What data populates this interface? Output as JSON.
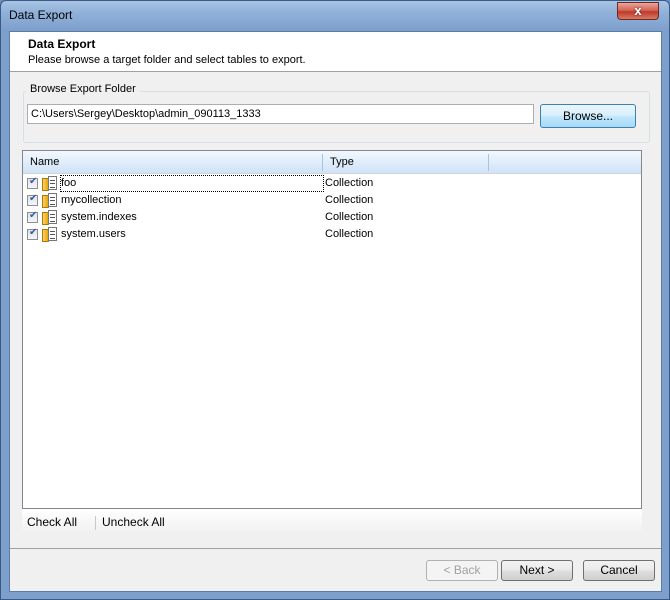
{
  "window": {
    "title": "Data Export",
    "close_label": "x"
  },
  "header": {
    "title": "Data Export",
    "subtitle": "Please browse a target folder and select tables to export."
  },
  "folder": {
    "group_label": "Browse Export Folder",
    "path": "C:\\Users\\Sergey\\Desktop\\admin_090113_1333",
    "browse_label": "Browse..."
  },
  "list": {
    "columns": [
      "Name",
      "Type"
    ],
    "rows": [
      {
        "name": "foo",
        "type": "Collection",
        "checked": true
      },
      {
        "name": "mycollection",
        "type": "Collection",
        "checked": true
      },
      {
        "name": "system.indexes",
        "type": "Collection",
        "checked": true
      },
      {
        "name": "system.users",
        "type": "Collection",
        "checked": true
      }
    ],
    "icon": "collection-icon"
  },
  "toolbar": {
    "check_all": "Check All",
    "uncheck_all": "Uncheck All"
  },
  "buttons": {
    "back": "< Back",
    "next": "Next >",
    "cancel": "Cancel"
  }
}
